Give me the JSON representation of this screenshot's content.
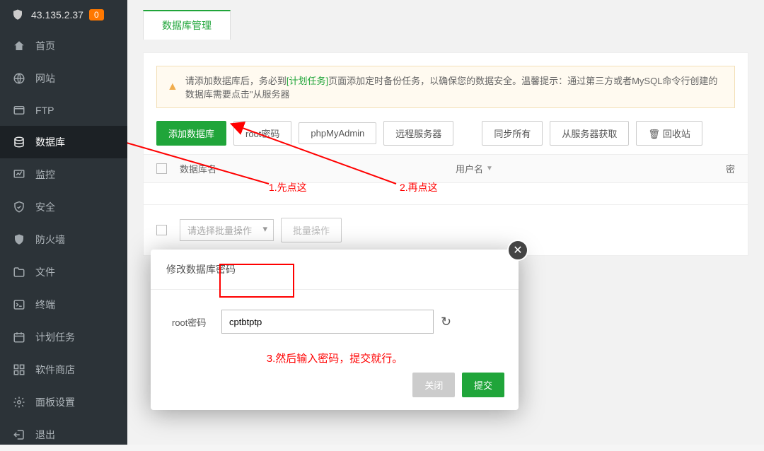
{
  "header": {
    "ip": "43.135.2.37",
    "badge": "0"
  },
  "nav": [
    {
      "label": "首页"
    },
    {
      "label": "网站"
    },
    {
      "label": "FTP"
    },
    {
      "label": "数据库"
    },
    {
      "label": "监控"
    },
    {
      "label": "安全"
    },
    {
      "label": "防火墙"
    },
    {
      "label": "文件"
    },
    {
      "label": "终端"
    },
    {
      "label": "计划任务"
    },
    {
      "label": "软件商店"
    },
    {
      "label": "面板设置"
    },
    {
      "label": "退出"
    }
  ],
  "active_nav_index": 3,
  "tab": "数据库管理",
  "warning": {
    "prefix": "请添加数据库后，务必到",
    "link": "[计划任务]",
    "suffix": "页面添加定时备份任务，以确保您的数据安全。温馨提示：通过第三方或者MySQL命令行创建的数据库需要点击\"从服务器"
  },
  "toolbar": {
    "add": "添加数据库",
    "root_pwd": "root密码",
    "phpmyadmin": "phpMyAdmin",
    "remote": "远程服务器",
    "sync_all": "同步所有",
    "get_from_server": "从服务器获取",
    "recycle": "回收站"
  },
  "table": {
    "col_name": "数据库名",
    "col_user": "用户名",
    "col_pwd_char": "密"
  },
  "batch": {
    "select_placeholder": "请选择批量操作",
    "batch_btn": "批量操作"
  },
  "annotations": {
    "step1": "1.先点这",
    "step2": "2.再点这",
    "step3": "3.然后输入密码，提交就行。"
  },
  "modal": {
    "title": "修改数据库密码",
    "label": "root密码",
    "value": "cptbtptp",
    "close_btn": "关闭",
    "submit_btn": "提交"
  }
}
